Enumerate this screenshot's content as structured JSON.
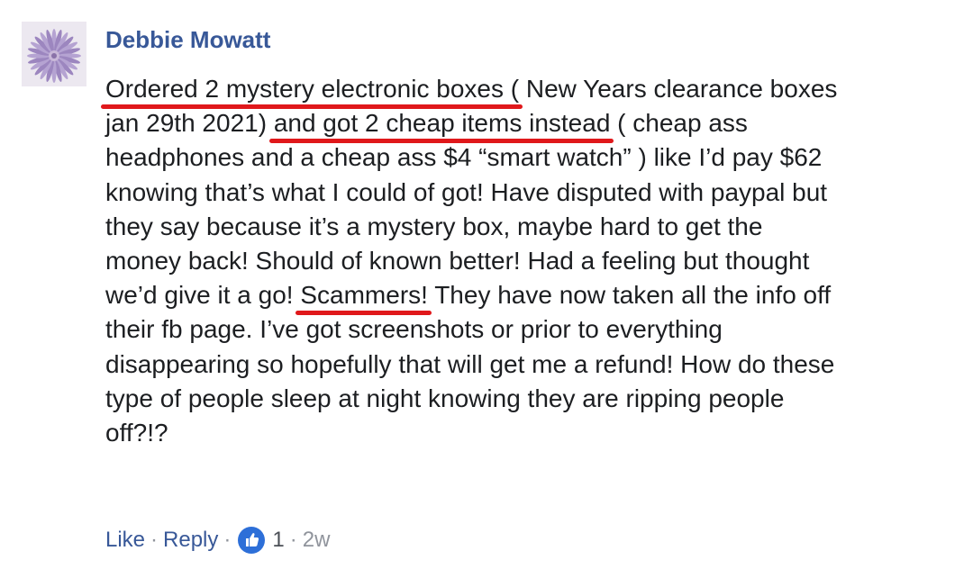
{
  "comment": {
    "author": "Debbie Mowatt",
    "body_lines": [
      {
        "segments": [
          {
            "text": "Ordered 2 mystery electronic boxes (",
            "underline": true
          },
          {
            "text": " New Years clearance boxes",
            "underline": false
          }
        ]
      },
      {
        "segments": [
          {
            "text": "jan 29th 2021) ",
            "underline": false
          },
          {
            "text": "and got 2 cheap items instead",
            "underline": true
          },
          {
            "text": " ( cheap ass",
            "underline": false
          }
        ]
      },
      {
        "segments": [
          {
            "text": "headphones and a cheap ass $4 “smart watch” ) like I’d pay $62",
            "underline": false
          }
        ]
      },
      {
        "segments": [
          {
            "text": "knowing that’s what I could of got! Have disputed with paypal but",
            "underline": false
          }
        ]
      },
      {
        "segments": [
          {
            "text": "they say because it’s a mystery box, maybe hard to get the",
            "underline": false
          }
        ]
      },
      {
        "segments": [
          {
            "text": "money back! Should of known better! Had a feeling but thought",
            "underline": false
          }
        ]
      },
      {
        "segments": [
          {
            "text": "we’d give it a go! ",
            "underline": false
          },
          {
            "text": "Scammers!",
            "underline": true
          },
          {
            "text": " They have now taken all the info off",
            "underline": false
          }
        ]
      },
      {
        "segments": [
          {
            "text": "their fb page. I’ve got screenshots or prior to everything",
            "underline": false
          }
        ]
      },
      {
        "segments": [
          {
            "text": "disappearing so hopefully that will get me a refund! How do these",
            "underline": false
          }
        ]
      },
      {
        "segments": [
          {
            "text": "type of people sleep at night knowing they are ripping people",
            "underline": false
          }
        ]
      },
      {
        "segments": [
          {
            "text": "off?!?",
            "underline": false
          }
        ]
      }
    ],
    "actions": {
      "like_label": "Like",
      "reply_label": "Reply",
      "separator": "·",
      "reaction_icon": "thumbs-up-icon",
      "reaction_count": "1",
      "timestamp": "2w"
    }
  },
  "colors": {
    "author": "#385898",
    "link": "#385898",
    "meta": "#90949c",
    "underline": "#e0181b",
    "like_badge": "#2d6fd8"
  }
}
